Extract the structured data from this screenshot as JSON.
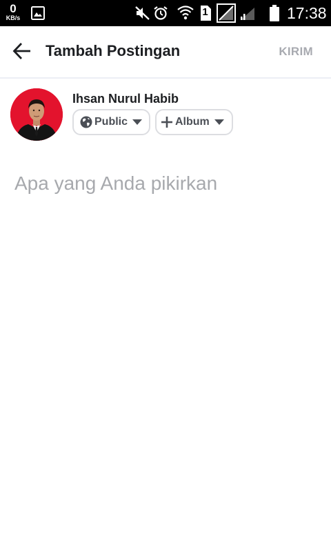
{
  "status_bar": {
    "net_speed_value": "0",
    "net_speed_unit": "KB/s",
    "sim_slot": "1",
    "time": "17:38"
  },
  "app_bar": {
    "title": "Tambah Postingan",
    "send_label": "KIRIM"
  },
  "composer": {
    "user_name": "Ihsan Nurul Habib",
    "privacy_label": "Public",
    "album_label": "Album",
    "placeholder": "Apa yang Anda pikirkan"
  },
  "colors": {
    "title": "#1c1e21",
    "send_disabled": "#a8aab0",
    "placeholder": "#a7a9ad",
    "avatar_bg": "#e3132d"
  },
  "icons": [
    "gallery-icon",
    "mute-icon",
    "alarm-icon",
    "wifi-icon",
    "sim-icon",
    "signal-icon",
    "battery-icon",
    "back-arrow-icon",
    "globe-icon",
    "plus-icon",
    "chevron-down-icon"
  ]
}
